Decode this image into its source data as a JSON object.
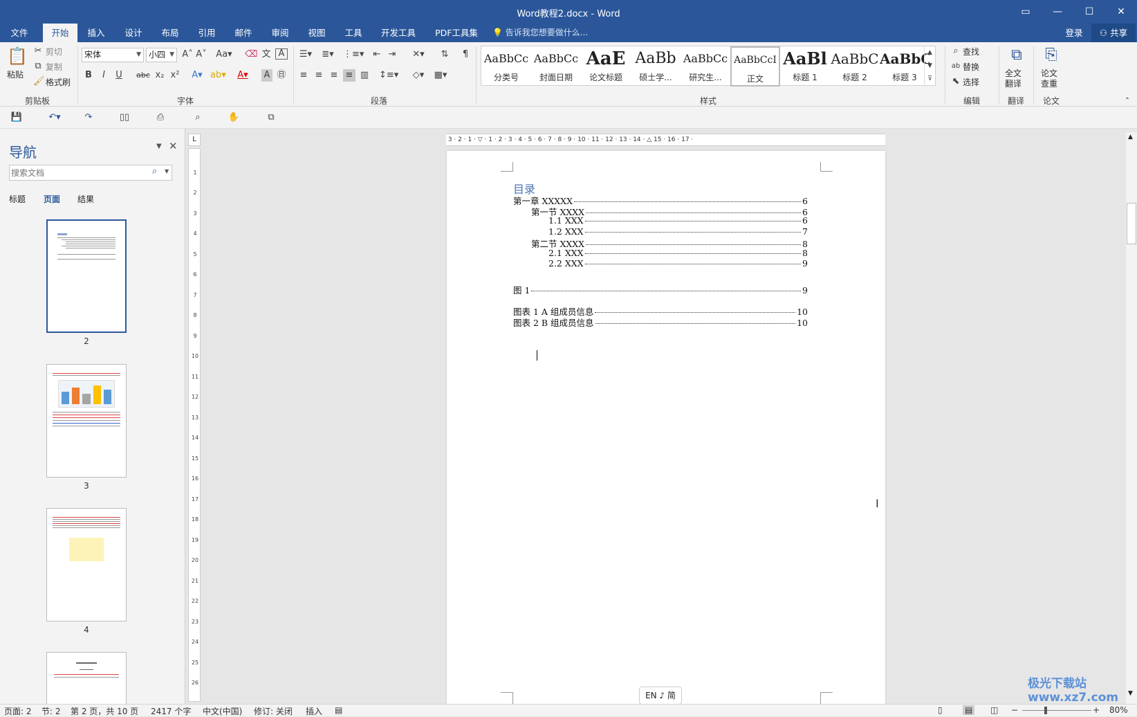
{
  "window": {
    "title": "Word教程2.docx - Word",
    "colors": {
      "accent": "#2b579a",
      "toc_heading": "#4a74b5"
    }
  },
  "tabs": [
    "文件",
    "开始",
    "插入",
    "设计",
    "布局",
    "引用",
    "邮件",
    "审阅",
    "视图",
    "工具",
    "开发工具",
    "PDF工具集"
  ],
  "active_tab": "开始",
  "tell_me": "告诉我您想要做什么...",
  "account": {
    "login": "登录",
    "share": "共享"
  },
  "ribbon": {
    "clipboard": {
      "paste": "粘贴",
      "cut": "剪切",
      "copy": "复制",
      "format_painter": "格式刷",
      "label": "剪贴板"
    },
    "font": {
      "name": "宋体",
      "size": "小四",
      "label": "字体"
    },
    "paragraph": {
      "label": "段落"
    },
    "styles": {
      "label": "样式",
      "items": [
        {
          "preview": "AaBbCc",
          "name": "分类号"
        },
        {
          "preview": "AaBbCc",
          "name": "封面日期"
        },
        {
          "preview": "AaE",
          "name": "论文标题"
        },
        {
          "preview": "AaBb",
          "name": "硕士学..."
        },
        {
          "preview": "AaBbCc",
          "name": "研究生..."
        },
        {
          "preview": "AaBbCcI",
          "name": "正文"
        },
        {
          "preview": "AaBl",
          "name": "标题 1"
        },
        {
          "preview": "AaBbC",
          "name": "标题 2"
        },
        {
          "preview": "AaBbC",
          "name": "标题 3"
        }
      ]
    },
    "editing": {
      "find": "查找",
      "replace": "替换",
      "select": "选择",
      "label": "编辑"
    },
    "translate": {
      "full": "全文\n翻译",
      "label": "翻译"
    },
    "paper": {
      "check": "论文\n查重",
      "label": "论文"
    }
  },
  "nav": {
    "title": "导航",
    "search_placeholder": "搜索文档",
    "tabs": [
      "标题",
      "页面",
      "结果"
    ],
    "active_tab": "页面",
    "pages": [
      "2",
      "3",
      "4"
    ]
  },
  "document": {
    "toc_heading": "目录",
    "toc": [
      {
        "text": "第一章  XXXXX",
        "page": "6",
        "level": 0
      },
      {
        "text": "第一节  XXXX",
        "page": "6",
        "level": 1
      },
      {
        "text": "1.1 XXX",
        "page": "6",
        "level": 2
      },
      {
        "text": "1.2 XXX",
        "page": "7",
        "level": 2
      },
      {
        "text": "第二节  XXXX",
        "page": "8",
        "level": 1
      },
      {
        "text": "2.1 XXX",
        "page": "8",
        "level": 2
      },
      {
        "text": "2.2 XXX",
        "page": "9",
        "level": 2
      }
    ],
    "figures": [
      {
        "text": "图  1",
        "page": "9"
      }
    ],
    "tables": [
      {
        "text": "图表  1    A 组成员信息",
        "page": "10"
      },
      {
        "text": "图表  2    B 组成员信息",
        "page": "10"
      }
    ]
  },
  "ime": "EN ♪ 简",
  "status": {
    "page_no": "页面: 2",
    "section": "节: 2",
    "page_of": "第 2 页，共 10 页",
    "words": "2417 个字",
    "lang": "中文(中国)",
    "track": "修订: 关闭",
    "mode": "插入",
    "zoom": "80%"
  },
  "watermark": "极光下载站 www.xz7.com"
}
